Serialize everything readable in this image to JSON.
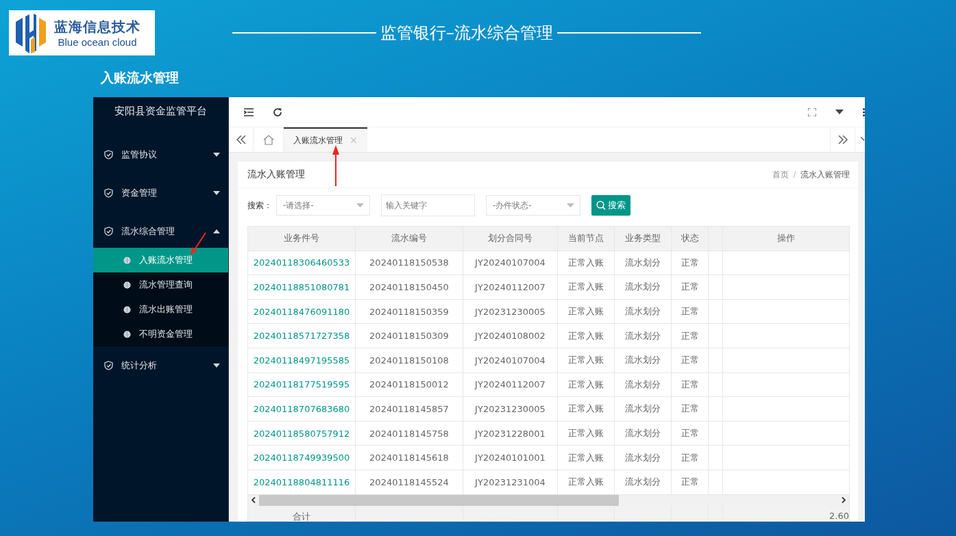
{
  "slide": {
    "logo": {
      "name": "蓝海信息技术",
      "tagline": "Blue ocean cloud"
    },
    "title": "监管银行–流水综合管理",
    "subtitle": "入账流水管理"
  },
  "app": {
    "platform": "安阳县资金监管平台",
    "menu": [
      {
        "label": "监管协议",
        "expanded": false
      },
      {
        "label": "资金管理",
        "expanded": false
      },
      {
        "label": "流水综合管理",
        "expanded": true,
        "children": [
          {
            "label": "入账流水管理",
            "selected": true
          },
          {
            "label": "流水管理查询",
            "selected": false
          },
          {
            "label": "流水出账管理",
            "selected": false
          },
          {
            "label": "不明资金管理",
            "selected": false
          }
        ]
      },
      {
        "label": "统计分析",
        "expanded": false
      }
    ],
    "tabs": [
      {
        "label": "入账流水管理",
        "selected": true
      }
    ],
    "page": {
      "title": "流水入账管理",
      "breadcrumb": [
        "首页",
        "流水入账管理"
      ],
      "search": {
        "label": "搜索：",
        "type": {
          "placeholder": "-请选择-"
        },
        "keyword": {
          "placeholder": "输入关键字"
        },
        "status": {
          "placeholder": "-办件状态-"
        },
        "button": "搜索"
      },
      "table": {
        "columns": [
          "业务件号",
          "流水编号",
          "划分合同号",
          "当前节点",
          "业务类型",
          "状态",
          "操作"
        ],
        "rows": [
          [
            "20240118306460533",
            "20240118150538",
            "JY20240107004",
            "正常入账",
            "流水划分",
            "正常"
          ],
          [
            "20240118851080781",
            "20240118150450",
            "JY20240112007",
            "正常入账",
            "流水划分",
            "正常"
          ],
          [
            "20240118476091180",
            "20240118150359",
            "JY20231230005",
            "正常入账",
            "流水划分",
            "正常"
          ],
          [
            "20240118571727358",
            "20240118150309",
            "JY20240108002",
            "正常入账",
            "流水划分",
            "正常"
          ],
          [
            "20240118497195585",
            "20240118150108",
            "JY20240107004",
            "正常入账",
            "流水划分",
            "正常"
          ],
          [
            "20240118177519595",
            "20240118150012",
            "JY20240112007",
            "正常入账",
            "流水划分",
            "正常"
          ],
          [
            "20240118707683680",
            "20240118145857",
            "JY20231230005",
            "正常入账",
            "流水划分",
            "正常"
          ],
          [
            "20240118580757912",
            "20240118145758",
            "JY20231228001",
            "正常入账",
            "流水划分",
            "正常"
          ],
          [
            "20240118749939500",
            "20240118145618",
            "JY20240101001",
            "正常入账",
            "流水划分",
            "正常"
          ],
          [
            "20240118804811116",
            "20240118145524",
            "JY20231231004",
            "正常入账",
            "流水划分",
            "正常"
          ]
        ],
        "footer": {
          "label": "合计",
          "amount": "2.60"
        }
      }
    }
  }
}
